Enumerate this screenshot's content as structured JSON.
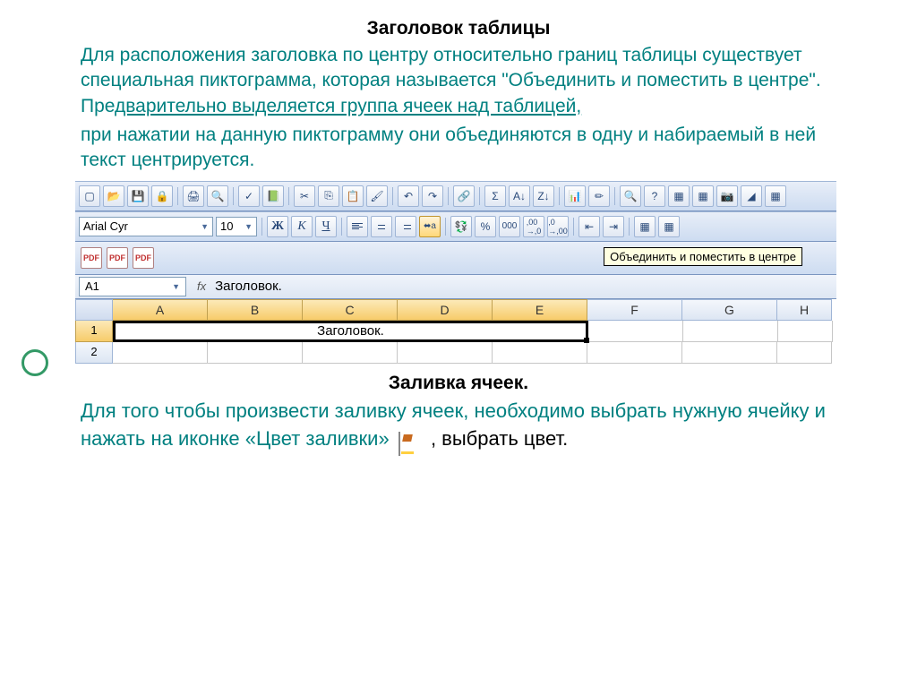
{
  "section1": {
    "title": "Заголовок таблицы",
    "p1": "Для расположения заголовка по центру относительно границ таблицы существует специальная пиктограмма, которая называется \"Объединить и поместить в центре\". Пре",
    "p1_underlined": "дварительно выделяется группа ячеек над таблицей,",
    "p2": "при нажатии на данную пиктограмму они объединяются в одну и набираемый в ней текст центрируется."
  },
  "excel": {
    "font_name": "Arial Cyr",
    "font_size": "10",
    "bold": "Ж",
    "italic": "К",
    "underline": "Ч",
    "percent": "%",
    "thousands": "000",
    "dec_inc": ",00",
    "dec_dec": ",0",
    "tooltip": "Объединить и поместить в центре",
    "namebox": "A1",
    "fx_label": "fx",
    "formula_value": "Заголовок.",
    "columns": [
      "A",
      "B",
      "C",
      "D",
      "E",
      "F",
      "G",
      "H"
    ],
    "rows": [
      "1",
      "2"
    ],
    "merged_text": "Заголовок."
  },
  "section2": {
    "title": "Заливка ячеек.",
    "p1": "Для того чтобы произвести заливку ячеек, необходимо выбрать нужную ячейку и нажать на иконке «Цвет заливки»",
    "trail": " , выбрать цвет."
  }
}
